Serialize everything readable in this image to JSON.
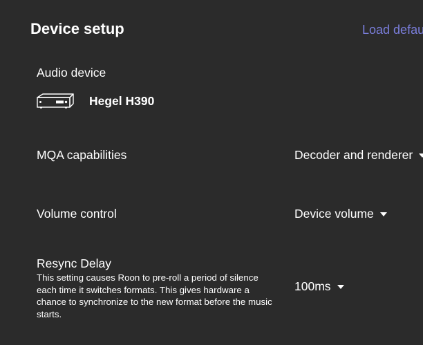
{
  "header": {
    "title": "Device setup",
    "load_defaults_label": "Load defau"
  },
  "colors": {
    "background": "#2b2b2b",
    "accent": "#7b7fdd",
    "text": "#ffffff"
  },
  "audio_device": {
    "label": "Audio device",
    "icon": "amplifier-icon",
    "name": "Hegel H390"
  },
  "mqa": {
    "label": "MQA capabilities",
    "value": "Decoder and renderer"
  },
  "volume": {
    "label": "Volume control",
    "value": "Device volume"
  },
  "resync": {
    "label": "Resync Delay",
    "description": "This setting causes Roon to pre-roll a period of silence each time it switches formats. This gives hardware a chance to synchronize to the new format before the music starts.",
    "value": "100ms"
  }
}
